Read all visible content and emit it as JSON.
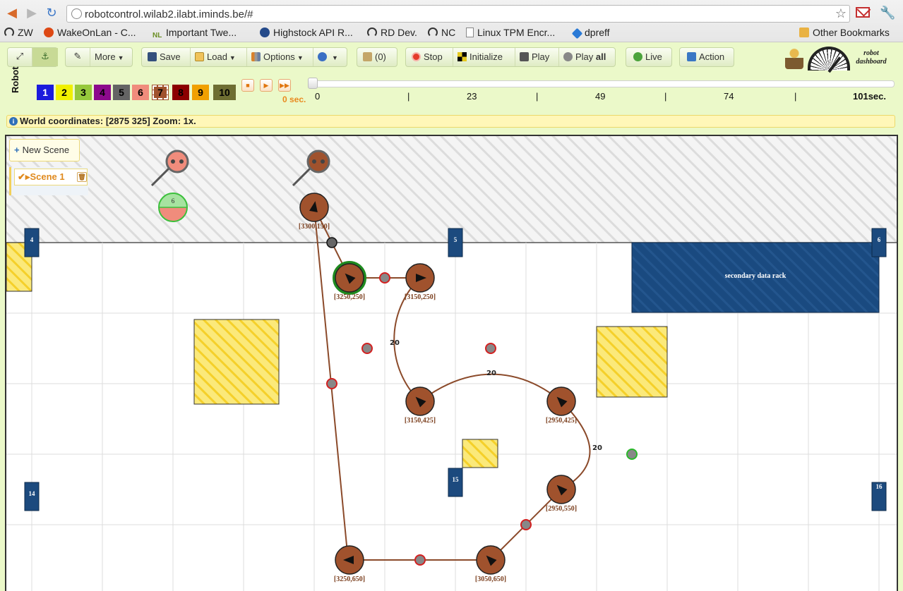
{
  "browser": {
    "url": "robotcontrol.wilab2.ilabt.iminds.be/#",
    "bookmarks": [
      "ZW",
      "WakeOnLan - C...",
      "Important Twe...",
      "Highstock API R...",
      "RD Dev.",
      "NC",
      "Linux TPM Encr...",
      "dpreff",
      "Other Bookmarks"
    ]
  },
  "toolbar": {
    "more": "More",
    "save": "Save",
    "load": "Load",
    "options": "Options",
    "clipboard": "(0)",
    "stop": "Stop",
    "initialize": "Initialize",
    "play": "Play",
    "play_all_prefix": "Play",
    "play_all_bold": "all",
    "live": "Live",
    "action": "Action",
    "logo_line1": "robot",
    "logo_line2": "dashboard"
  },
  "robot_selector": {
    "label": "Robot",
    "robots": [
      {
        "label": "1",
        "color": "#1b1bdc",
        "text_color": "#ffffff"
      },
      {
        "label": "2",
        "color": "#f0f000",
        "text_color": "#000000"
      },
      {
        "label": "3",
        "color": "#96c83c",
        "text_color": "#000000"
      },
      {
        "label": "4",
        "color": "#8c0a8c",
        "text_color": "#000000"
      },
      {
        "label": "5",
        "color": "#646464",
        "text_color": "#000000"
      },
      {
        "label": "6",
        "color": "#f08c7c",
        "text_color": "#000000"
      },
      {
        "label": "7",
        "color": "#a0522d",
        "text_color": "#000000",
        "selected": true
      },
      {
        "label": "8",
        "color": "#8c0000",
        "text_color": "#000000"
      },
      {
        "label": "9",
        "color": "#f0a000",
        "text_color": "#000000"
      },
      {
        "label": "10",
        "color": "#6e6e32",
        "text_color": "#000000"
      }
    ]
  },
  "timeline": {
    "current": "0 sec.",
    "start": "0",
    "labels": [
      "23",
      "49",
      "74"
    ],
    "end": "101sec."
  },
  "world": {
    "info": "World coordinates: [2875 325] Zoom: 1x."
  },
  "scene_panel": {
    "new_scene": "New Scene",
    "scene_name": "Scene 1"
  },
  "scene": {
    "rack_label": "secondary data rack",
    "markers": [
      "4",
      "5",
      "6",
      "14",
      "15",
      "16"
    ],
    "robot6_label": "6",
    "weight_label": "20",
    "nodes": [
      {
        "id": "n1",
        "label": "[3300,150]"
      },
      {
        "id": "n2",
        "label": "[3250,250]"
      },
      {
        "id": "n3",
        "label": "[3150,250]"
      },
      {
        "id": "n4",
        "label": "[3150,425]"
      },
      {
        "id": "n5",
        "label": "[2950,425]"
      },
      {
        "id": "n6",
        "label": "[2950,550]"
      },
      {
        "id": "n7",
        "label": "[3250,650]"
      },
      {
        "id": "n8",
        "label": "[3050,650]"
      }
    ],
    "colors": {
      "node": "#a0522d",
      "path": "#8b4a2a",
      "rack": "#1c4a7e",
      "obstacle": "#f5d733",
      "waypoint": "#d32020",
      "charger_pink": "#f08c7c",
      "charger_brown": "#a0522d"
    }
  }
}
